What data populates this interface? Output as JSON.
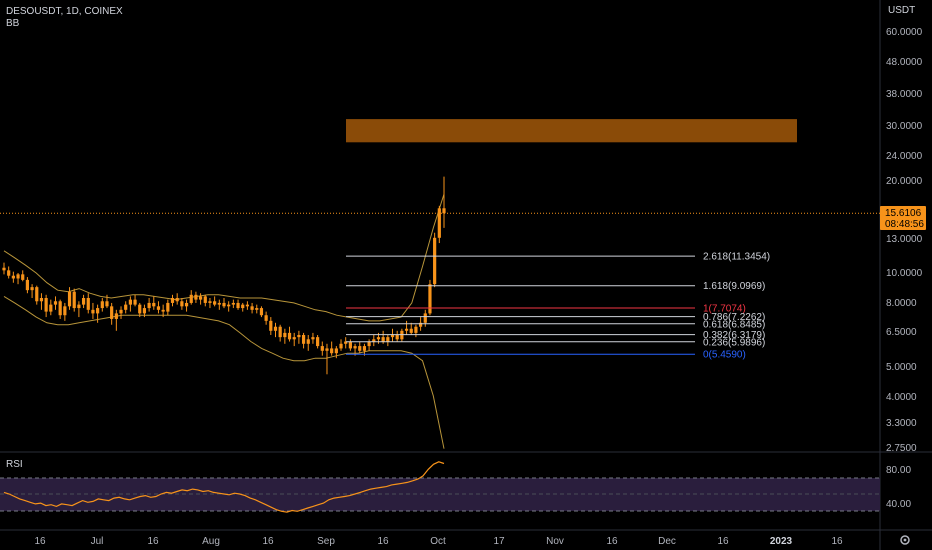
{
  "header": {
    "symbol_line": "DESOUSDT, 1D, COINEX",
    "indicator": "BB"
  },
  "price_axis": {
    "unit": "USDT",
    "ticks": [
      "60.0000",
      "48.0000",
      "38.0000",
      "30.0000",
      "24.0000",
      "20.0000",
      "13.0000",
      "10.0000",
      "8.0000",
      "6.5000",
      "5.0000",
      "4.0000",
      "3.3000",
      "2.7500"
    ],
    "current_price": "15.6106",
    "countdown": "08:48:56"
  },
  "rsi": {
    "label": "RSI",
    "ticks": [
      "80.00",
      "40.00"
    ]
  },
  "time_axis": {
    "labels": [
      "16",
      "Jul",
      "16",
      "Aug",
      "16",
      "Sep",
      "16",
      "Oct",
      "17",
      "Nov",
      "16",
      "Dec",
      "16",
      "2023",
      "16"
    ]
  },
  "fib_levels": [
    {
      "label": "2.618(11.3454)",
      "color": "#d1d4dc"
    },
    {
      "label": "1.618(9.0969)",
      "color": "#d1d4dc"
    },
    {
      "label": "1(7.7074)",
      "color": "#f23645"
    },
    {
      "label": "0.786(7.2262)",
      "color": "#d1d4dc"
    },
    {
      "label": "0.618(6.8485)",
      "color": "#d1d4dc"
    },
    {
      "label": "0.382(6.3179)",
      "color": "#d1d4dc"
    },
    {
      "label": "0.236(5.9896)",
      "color": "#d1d4dc"
    },
    {
      "label": "0(5.4590)",
      "color": "#2962ff"
    }
  ],
  "colors": {
    "candle": "#f7931a",
    "band": "#b8953a",
    "zone": "#8a4b08",
    "rsi_line": "#f7931a",
    "rsi_band": "#2a1e3d",
    "price_tag": "#f7931a"
  },
  "chart_data": {
    "type": "candlestick",
    "symbol": "DESOUSDT",
    "interval": "1D",
    "exchange": "COINEX",
    "scale": "log",
    "ylim": [
      2.7,
      65
    ],
    "x_range": [
      "2022-06-07",
      "2023-01-25"
    ],
    "candles_ohlc": [
      [
        10.4,
        10.8,
        9.9,
        10.2
      ],
      [
        10.2,
        10.5,
        9.6,
        9.8
      ],
      [
        9.8,
        10.1,
        9.3,
        9.6
      ],
      [
        9.6,
        10.0,
        9.2,
        9.9
      ],
      [
        9.9,
        10.2,
        9.4,
        9.5
      ],
      [
        9.5,
        9.7,
        8.6,
        8.8
      ],
      [
        8.8,
        9.2,
        8.3,
        9.0
      ],
      [
        9.0,
        9.1,
        7.9,
        8.1
      ],
      [
        8.1,
        8.6,
        7.6,
        8.3
      ],
      [
        8.3,
        8.5,
        7.2,
        7.5
      ],
      [
        7.5,
        8.2,
        7.3,
        7.9
      ],
      [
        7.9,
        8.4,
        7.6,
        8.1
      ],
      [
        8.1,
        8.2,
        7.1,
        7.3
      ],
      [
        7.3,
        8.0,
        7.0,
        7.8
      ],
      [
        7.8,
        9.0,
        7.6,
        8.7
      ],
      [
        8.7,
        8.9,
        7.5,
        7.7
      ],
      [
        7.7,
        8.1,
        7.2,
        7.9
      ],
      [
        7.9,
        8.5,
        7.7,
        8.3
      ],
      [
        8.3,
        8.6,
        7.4,
        7.6
      ],
      [
        7.6,
        8.0,
        7.1,
        7.4
      ],
      [
        7.4,
        7.9,
        6.9,
        7.7
      ],
      [
        7.7,
        8.3,
        7.5,
        8.1
      ],
      [
        8.1,
        8.5,
        7.7,
        7.8
      ],
      [
        7.8,
        8.0,
        6.8,
        7.1
      ],
      [
        7.1,
        7.6,
        6.5,
        7.4
      ],
      [
        7.4,
        7.8,
        7.1,
        7.6
      ],
      [
        7.6,
        8.1,
        7.4,
        7.9
      ],
      [
        7.9,
        8.4,
        7.5,
        8.2
      ],
      [
        8.2,
        8.5,
        7.8,
        7.9
      ],
      [
        7.9,
        8.0,
        7.2,
        7.4
      ],
      [
        7.4,
        7.9,
        7.2,
        7.7
      ],
      [
        7.7,
        8.3,
        7.5,
        8.0
      ],
      [
        8.0,
        8.4,
        7.6,
        7.8
      ],
      [
        7.8,
        8.1,
        7.4,
        7.6
      ],
      [
        7.6,
        7.9,
        7.2,
        7.5
      ],
      [
        7.5,
        8.2,
        7.3,
        8.0
      ],
      [
        8.0,
        8.5,
        7.8,
        8.3
      ],
      [
        8.3,
        8.6,
        7.9,
        8.1
      ],
      [
        8.1,
        8.3,
        7.6,
        7.8
      ],
      [
        7.8,
        8.2,
        7.5,
        8.0
      ],
      [
        8.0,
        8.8,
        7.9,
        8.5
      ],
      [
        8.5,
        8.7,
        8.0,
        8.2
      ],
      [
        8.2,
        8.6,
        7.9,
        8.4
      ],
      [
        8.4,
        8.5,
        7.8,
        8.0
      ],
      [
        8.0,
        8.3,
        7.7,
        8.1
      ],
      [
        8.1,
        8.4,
        7.8,
        7.9
      ],
      [
        7.9,
        8.2,
        7.6,
        8.0
      ],
      [
        8.0,
        8.3,
        7.7,
        7.8
      ],
      [
        7.8,
        8.1,
        7.5,
        7.9
      ],
      [
        7.9,
        8.2,
        7.7,
        8.0
      ],
      [
        8.0,
        8.2,
        7.6,
        7.7
      ],
      [
        7.7,
        8.0,
        7.5,
        7.9
      ],
      [
        7.9,
        8.1,
        7.6,
        7.8
      ],
      [
        7.8,
        8.0,
        7.4,
        7.6
      ],
      [
        7.6,
        7.9,
        7.4,
        7.7
      ],
      [
        7.7,
        7.8,
        7.2,
        7.3
      ],
      [
        7.3,
        7.5,
        6.8,
        7.0
      ],
      [
        7.0,
        7.2,
        6.3,
        6.5
      ],
      [
        6.5,
        6.9,
        6.2,
        6.7
      ],
      [
        6.7,
        6.8,
        6.0,
        6.2
      ],
      [
        6.2,
        6.6,
        5.9,
        6.4
      ],
      [
        6.4,
        6.7,
        6.0,
        6.1
      ],
      [
        6.1,
        6.4,
        5.8,
        6.2
      ],
      [
        6.2,
        6.5,
        5.9,
        6.3
      ],
      [
        6.3,
        6.4,
        5.7,
        5.9
      ],
      [
        5.9,
        6.3,
        5.6,
        6.1
      ],
      [
        6.1,
        6.4,
        5.9,
        6.2
      ],
      [
        6.2,
        6.3,
        5.7,
        5.8
      ],
      [
        5.8,
        6.0,
        5.4,
        5.6
      ],
      [
        5.6,
        5.9,
        4.7,
        5.7
      ],
      [
        5.7,
        6.0,
        5.4,
        5.5
      ],
      [
        5.5,
        5.8,
        5.3,
        5.7
      ],
      [
        5.7,
        6.1,
        5.6,
        5.9
      ],
      [
        5.9,
        6.2,
        5.7,
        6.0
      ],
      [
        6.0,
        6.1,
        5.6,
        5.7
      ],
      [
        5.7,
        5.9,
        5.4,
        5.8
      ],
      [
        5.8,
        6.0,
        5.5,
        5.6
      ],
      [
        5.6,
        5.9,
        5.4,
        5.8
      ],
      [
        5.8,
        6.1,
        5.6,
        6.0
      ],
      [
        6.0,
        6.3,
        5.8,
        6.1
      ],
      [
        6.1,
        6.4,
        5.9,
        6.2
      ],
      [
        6.2,
        6.5,
        5.9,
        6.0
      ],
      [
        6.0,
        6.3,
        5.8,
        6.2
      ],
      [
        6.2,
        6.6,
        6.0,
        6.3
      ],
      [
        6.3,
        6.5,
        6.0,
        6.1
      ],
      [
        6.1,
        6.6,
        6.0,
        6.5
      ],
      [
        6.5,
        7.0,
        6.3,
        6.6
      ],
      [
        6.6,
        6.9,
        6.3,
        6.4
      ],
      [
        6.4,
        6.8,
        6.2,
        6.7
      ],
      [
        6.7,
        7.2,
        6.5,
        6.9
      ],
      [
        6.9,
        7.6,
        6.7,
        7.4
      ],
      [
        7.4,
        9.5,
        7.3,
        9.2
      ],
      [
        9.2,
        13.5,
        9.0,
        13.0
      ],
      [
        13.0,
        16.5,
        12.5,
        16.2
      ],
      [
        16.2,
        20.5,
        14.0,
        15.61
      ]
    ],
    "bollinger_upper_path": [
      11.8,
      11.2,
      10.6,
      10.0,
      9.3,
      8.8,
      8.7,
      8.9,
      8.6,
      8.4,
      8.3,
      8.4,
      8.5,
      8.5,
      8.4,
      8.3,
      8.2,
      8.3,
      8.4,
      8.5,
      8.5,
      8.4,
      8.3,
      8.3,
      8.3,
      8.2,
      8.1,
      8.0,
      7.8,
      7.6,
      7.5,
      7.3,
      7.2,
      7.1,
      7.0,
      7.0,
      7.1,
      7.2,
      8.0,
      10.5,
      14.0,
      18.0
    ],
    "bollinger_lower_path": [
      8.4,
      8.0,
      7.6,
      7.2,
      6.9,
      6.8,
      6.8,
      6.9,
      7.0,
      7.1,
      7.2,
      7.3,
      7.3,
      7.3,
      7.3,
      7.3,
      7.3,
      7.3,
      7.2,
      7.1,
      7.0,
      6.8,
      6.4,
      6.0,
      5.7,
      5.5,
      5.3,
      5.2,
      5.2,
      5.3,
      5.3,
      5.4,
      5.5,
      5.5,
      5.6,
      5.6,
      5.6,
      5.6,
      5.5,
      5.2,
      4.0,
      2.7
    ],
    "fibonacci": [
      {
        "ratio": 2.618,
        "price": 11.3454
      },
      {
        "ratio": 1.618,
        "price": 9.0969
      },
      {
        "ratio": 1,
        "price": 7.7074
      },
      {
        "ratio": 0.786,
        "price": 7.2262
      },
      {
        "ratio": 0.618,
        "price": 6.8485
      },
      {
        "ratio": 0.382,
        "price": 6.3179
      },
      {
        "ratio": 0.236,
        "price": 5.9896
      },
      {
        "ratio": 0,
        "price": 5.459
      }
    ],
    "zone": {
      "price_low": 26.5,
      "price_high": 31.5
    },
    "rsi_series": [
      52,
      50,
      47,
      44,
      42,
      40,
      38,
      39,
      36,
      37,
      35,
      38,
      37,
      36,
      39,
      42,
      40,
      41,
      44,
      43,
      42,
      45,
      46,
      44,
      43,
      45,
      47,
      48,
      46,
      47,
      50,
      52,
      51,
      53,
      55,
      54,
      56,
      55,
      53,
      54,
      52,
      51,
      50,
      49,
      51,
      50,
      48,
      45,
      43,
      40,
      37,
      34,
      31,
      29,
      28,
      30,
      29,
      31,
      33,
      35,
      37,
      39,
      43,
      45,
      46,
      47,
      48,
      50,
      52,
      54,
      56,
      57,
      58,
      59,
      61,
      62,
      63,
      64,
      66,
      68,
      72,
      80,
      86,
      89,
      87
    ],
    "rsi_ylim": [
      20,
      92
    ],
    "rsi_band": [
      30,
      70
    ],
    "rsi_mid": 50
  }
}
